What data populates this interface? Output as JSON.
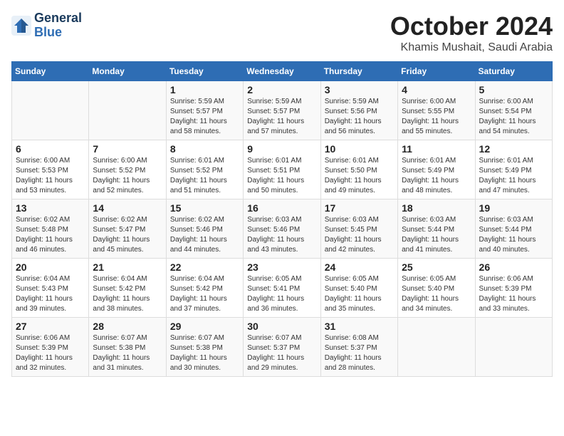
{
  "header": {
    "logo_general": "General",
    "logo_blue": "Blue",
    "title": "October 2024",
    "location": "Khamis Mushait, Saudi Arabia"
  },
  "days_of_week": [
    "Sunday",
    "Monday",
    "Tuesday",
    "Wednesday",
    "Thursday",
    "Friday",
    "Saturday"
  ],
  "weeks": [
    [
      {
        "day": "",
        "content": ""
      },
      {
        "day": "",
        "content": ""
      },
      {
        "day": "1",
        "content": "Sunrise: 5:59 AM\nSunset: 5:57 PM\nDaylight: 11 hours and 58 minutes."
      },
      {
        "day": "2",
        "content": "Sunrise: 5:59 AM\nSunset: 5:57 PM\nDaylight: 11 hours and 57 minutes."
      },
      {
        "day": "3",
        "content": "Sunrise: 5:59 AM\nSunset: 5:56 PM\nDaylight: 11 hours and 56 minutes."
      },
      {
        "day": "4",
        "content": "Sunrise: 6:00 AM\nSunset: 5:55 PM\nDaylight: 11 hours and 55 minutes."
      },
      {
        "day": "5",
        "content": "Sunrise: 6:00 AM\nSunset: 5:54 PM\nDaylight: 11 hours and 54 minutes."
      }
    ],
    [
      {
        "day": "6",
        "content": "Sunrise: 6:00 AM\nSunset: 5:53 PM\nDaylight: 11 hours and 53 minutes."
      },
      {
        "day": "7",
        "content": "Sunrise: 6:00 AM\nSunset: 5:52 PM\nDaylight: 11 hours and 52 minutes."
      },
      {
        "day": "8",
        "content": "Sunrise: 6:01 AM\nSunset: 5:52 PM\nDaylight: 11 hours and 51 minutes."
      },
      {
        "day": "9",
        "content": "Sunrise: 6:01 AM\nSunset: 5:51 PM\nDaylight: 11 hours and 50 minutes."
      },
      {
        "day": "10",
        "content": "Sunrise: 6:01 AM\nSunset: 5:50 PM\nDaylight: 11 hours and 49 minutes."
      },
      {
        "day": "11",
        "content": "Sunrise: 6:01 AM\nSunset: 5:49 PM\nDaylight: 11 hours and 48 minutes."
      },
      {
        "day": "12",
        "content": "Sunrise: 6:01 AM\nSunset: 5:49 PM\nDaylight: 11 hours and 47 minutes."
      }
    ],
    [
      {
        "day": "13",
        "content": "Sunrise: 6:02 AM\nSunset: 5:48 PM\nDaylight: 11 hours and 46 minutes."
      },
      {
        "day": "14",
        "content": "Sunrise: 6:02 AM\nSunset: 5:47 PM\nDaylight: 11 hours and 45 minutes."
      },
      {
        "day": "15",
        "content": "Sunrise: 6:02 AM\nSunset: 5:46 PM\nDaylight: 11 hours and 44 minutes."
      },
      {
        "day": "16",
        "content": "Sunrise: 6:03 AM\nSunset: 5:46 PM\nDaylight: 11 hours and 43 minutes."
      },
      {
        "day": "17",
        "content": "Sunrise: 6:03 AM\nSunset: 5:45 PM\nDaylight: 11 hours and 42 minutes."
      },
      {
        "day": "18",
        "content": "Sunrise: 6:03 AM\nSunset: 5:44 PM\nDaylight: 11 hours and 41 minutes."
      },
      {
        "day": "19",
        "content": "Sunrise: 6:03 AM\nSunset: 5:44 PM\nDaylight: 11 hours and 40 minutes."
      }
    ],
    [
      {
        "day": "20",
        "content": "Sunrise: 6:04 AM\nSunset: 5:43 PM\nDaylight: 11 hours and 39 minutes."
      },
      {
        "day": "21",
        "content": "Sunrise: 6:04 AM\nSunset: 5:42 PM\nDaylight: 11 hours and 38 minutes."
      },
      {
        "day": "22",
        "content": "Sunrise: 6:04 AM\nSunset: 5:42 PM\nDaylight: 11 hours and 37 minutes."
      },
      {
        "day": "23",
        "content": "Sunrise: 6:05 AM\nSunset: 5:41 PM\nDaylight: 11 hours and 36 minutes."
      },
      {
        "day": "24",
        "content": "Sunrise: 6:05 AM\nSunset: 5:40 PM\nDaylight: 11 hours and 35 minutes."
      },
      {
        "day": "25",
        "content": "Sunrise: 6:05 AM\nSunset: 5:40 PM\nDaylight: 11 hours and 34 minutes."
      },
      {
        "day": "26",
        "content": "Sunrise: 6:06 AM\nSunset: 5:39 PM\nDaylight: 11 hours and 33 minutes."
      }
    ],
    [
      {
        "day": "27",
        "content": "Sunrise: 6:06 AM\nSunset: 5:39 PM\nDaylight: 11 hours and 32 minutes."
      },
      {
        "day": "28",
        "content": "Sunrise: 6:07 AM\nSunset: 5:38 PM\nDaylight: 11 hours and 31 minutes."
      },
      {
        "day": "29",
        "content": "Sunrise: 6:07 AM\nSunset: 5:38 PM\nDaylight: 11 hours and 30 minutes."
      },
      {
        "day": "30",
        "content": "Sunrise: 6:07 AM\nSunset: 5:37 PM\nDaylight: 11 hours and 29 minutes."
      },
      {
        "day": "31",
        "content": "Sunrise: 6:08 AM\nSunset: 5:37 PM\nDaylight: 11 hours and 28 minutes."
      },
      {
        "day": "",
        "content": ""
      },
      {
        "day": "",
        "content": ""
      }
    ]
  ]
}
